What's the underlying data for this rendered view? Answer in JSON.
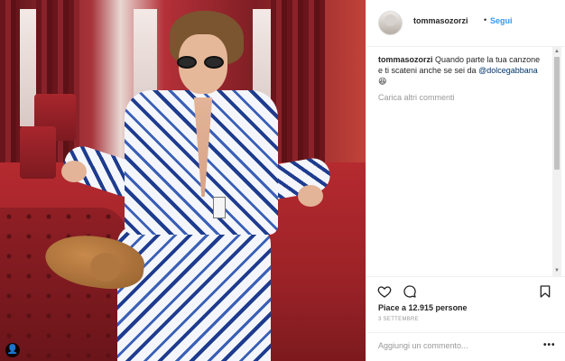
{
  "post": {
    "username": "tommasozorzi",
    "separator": "•",
    "follow_label": "Segui",
    "caption": {
      "username": "tommasozorzi",
      "text": " Quando parte la tua canzone e ti scateni anche se sei da ",
      "mention": "@dolcegabbana",
      "emoji": " 😆"
    },
    "load_more_label": "Carica altri commenti",
    "likes_text": "Piace a 12.915 persone",
    "date_text": "3 SETTEMBRE",
    "add_comment_placeholder": "Aggiungi un commento...",
    "more_label": "•••"
  },
  "photo": {
    "user_tag_icon": "person-icon",
    "user_tag_glyph": "👤"
  },
  "icons": {
    "like": "heart-icon",
    "comment": "comment-bubble-icon",
    "save": "bookmark-icon"
  },
  "colors": {
    "link_blue": "#3897f0",
    "mention_blue": "#003569",
    "muted_grey": "#999999",
    "text": "#262626"
  }
}
